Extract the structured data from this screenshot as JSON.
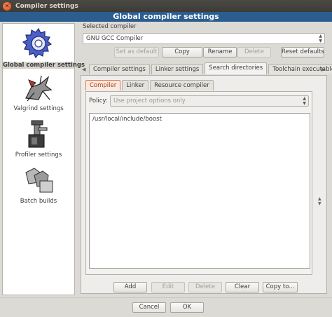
{
  "window": {
    "title": "Compiler settings",
    "header": "Global compiler settings"
  },
  "sidebar": {
    "items": [
      {
        "label": "Global compiler settings",
        "icon": "gear-icon",
        "selected": true
      },
      {
        "label": "Valgrind settings",
        "icon": "valgrind-icon",
        "selected": false
      },
      {
        "label": "Profiler settings",
        "icon": "profiler-icon",
        "selected": false
      },
      {
        "label": "Batch builds",
        "icon": "batch-builds-icon",
        "selected": false
      }
    ]
  },
  "compiler": {
    "selected_label": "Selected compiler",
    "selected_value": "GNU GCC Compiler",
    "buttons": {
      "set_default": "Set as default",
      "copy": "Copy",
      "rename": "Rename",
      "delete": "Delete",
      "reset_defaults": "Reset defaults"
    }
  },
  "tabs": [
    {
      "label": "Compiler settings"
    },
    {
      "label": "Linker settings"
    },
    {
      "label": "Search directories"
    },
    {
      "label": "Toolchain executables"
    }
  ],
  "subtabs": [
    {
      "label": "Compiler"
    },
    {
      "label": "Linker"
    },
    {
      "label": "Resource compiler"
    }
  ],
  "policy": {
    "label": "Policy:",
    "value": "Use project options only"
  },
  "directories": [
    "/usr/local/include/boost"
  ],
  "dir_buttons": {
    "add": "Add",
    "edit": "Edit",
    "delete": "Delete",
    "clear": "Clear",
    "copy_to": "Copy to..."
  },
  "dialog_buttons": {
    "cancel": "Cancel",
    "ok": "OK"
  },
  "colors": {
    "header_bg": "#2b5d8f",
    "close_button": "#df4a16",
    "active_subtab": "#e07a4a"
  }
}
